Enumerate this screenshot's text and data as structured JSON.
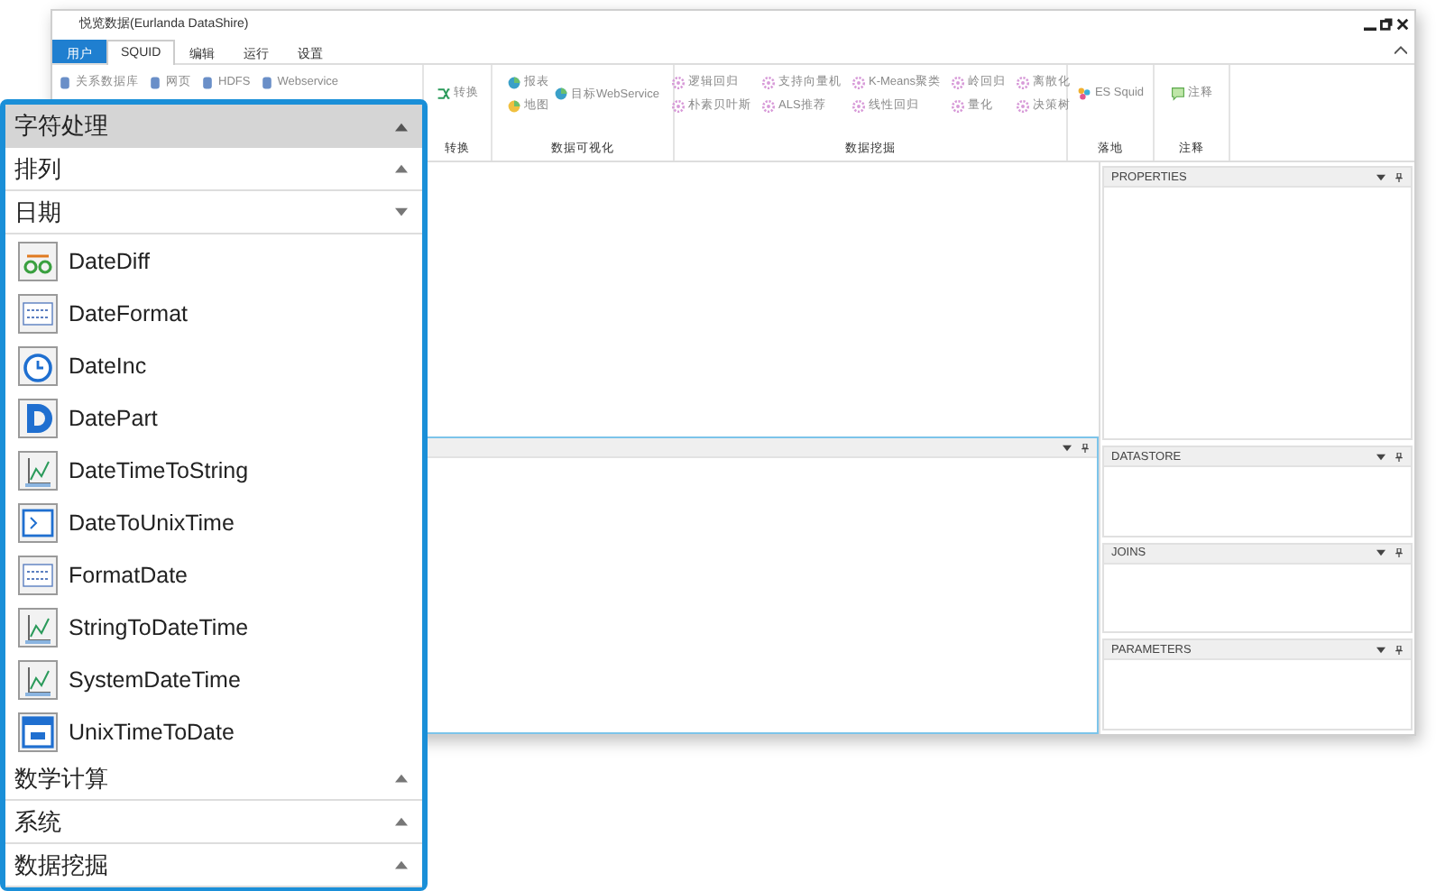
{
  "window": {
    "title": "悦览数据(Eurlanda DataShire)"
  },
  "menu_tabs": [
    {
      "label": "用户",
      "kind": "app"
    },
    {
      "label": "SQUID",
      "kind": "tab",
      "selected": true
    },
    {
      "label": "编辑",
      "kind": "tab",
      "selected": false
    },
    {
      "label": "运行",
      "kind": "tab",
      "selected": false
    },
    {
      "label": "设置",
      "kind": "tab",
      "selected": false
    }
  ],
  "ribbon_groups": [
    {
      "kind": "sources",
      "items": [
        "关系数据库",
        "网页",
        "HDFS",
        "Webservice"
      ]
    },
    {
      "kind": "transform",
      "label": "转换",
      "items": [
        "转换"
      ]
    },
    {
      "kind": "visual",
      "label": "数据可视化",
      "items": [
        "报表",
        "地图",
        "目标WebService"
      ]
    },
    {
      "kind": "mining",
      "label": "数据挖掘",
      "items": [
        "逻辑回归",
        "朴素贝叶斯",
        "支持向量机",
        "ALS推荐",
        "K-Means聚类",
        "线性回归",
        "岭回归",
        "量化",
        "离散化",
        "决策树"
      ]
    },
    {
      "kind": "landing",
      "label": "落地",
      "items": [
        "ES Squid"
      ]
    },
    {
      "kind": "note",
      "label": "注释",
      "items": [
        "注释"
      ]
    }
  ],
  "side_panels": [
    "PROPERTIES",
    "DATASTORE",
    "JOINS",
    "PARAMETERS"
  ],
  "toolbox": {
    "title": "字符处理",
    "categories": [
      {
        "label": "排列",
        "expanded": false
      },
      {
        "label": "日期",
        "expanded": true,
        "items": [
          "DateDiff",
          "DateFormat",
          "DateInc",
          "DatePart",
          "DateTimeToString",
          "DateToUnixTime",
          "FormatDate",
          "StringToDateTime",
          "SystemDateTime",
          "UnixTimeToDate"
        ]
      },
      {
        "label": "数学计算",
        "expanded": false
      },
      {
        "label": "系统",
        "expanded": false
      },
      {
        "label": "数据挖掘",
        "expanded": false
      }
    ]
  }
}
